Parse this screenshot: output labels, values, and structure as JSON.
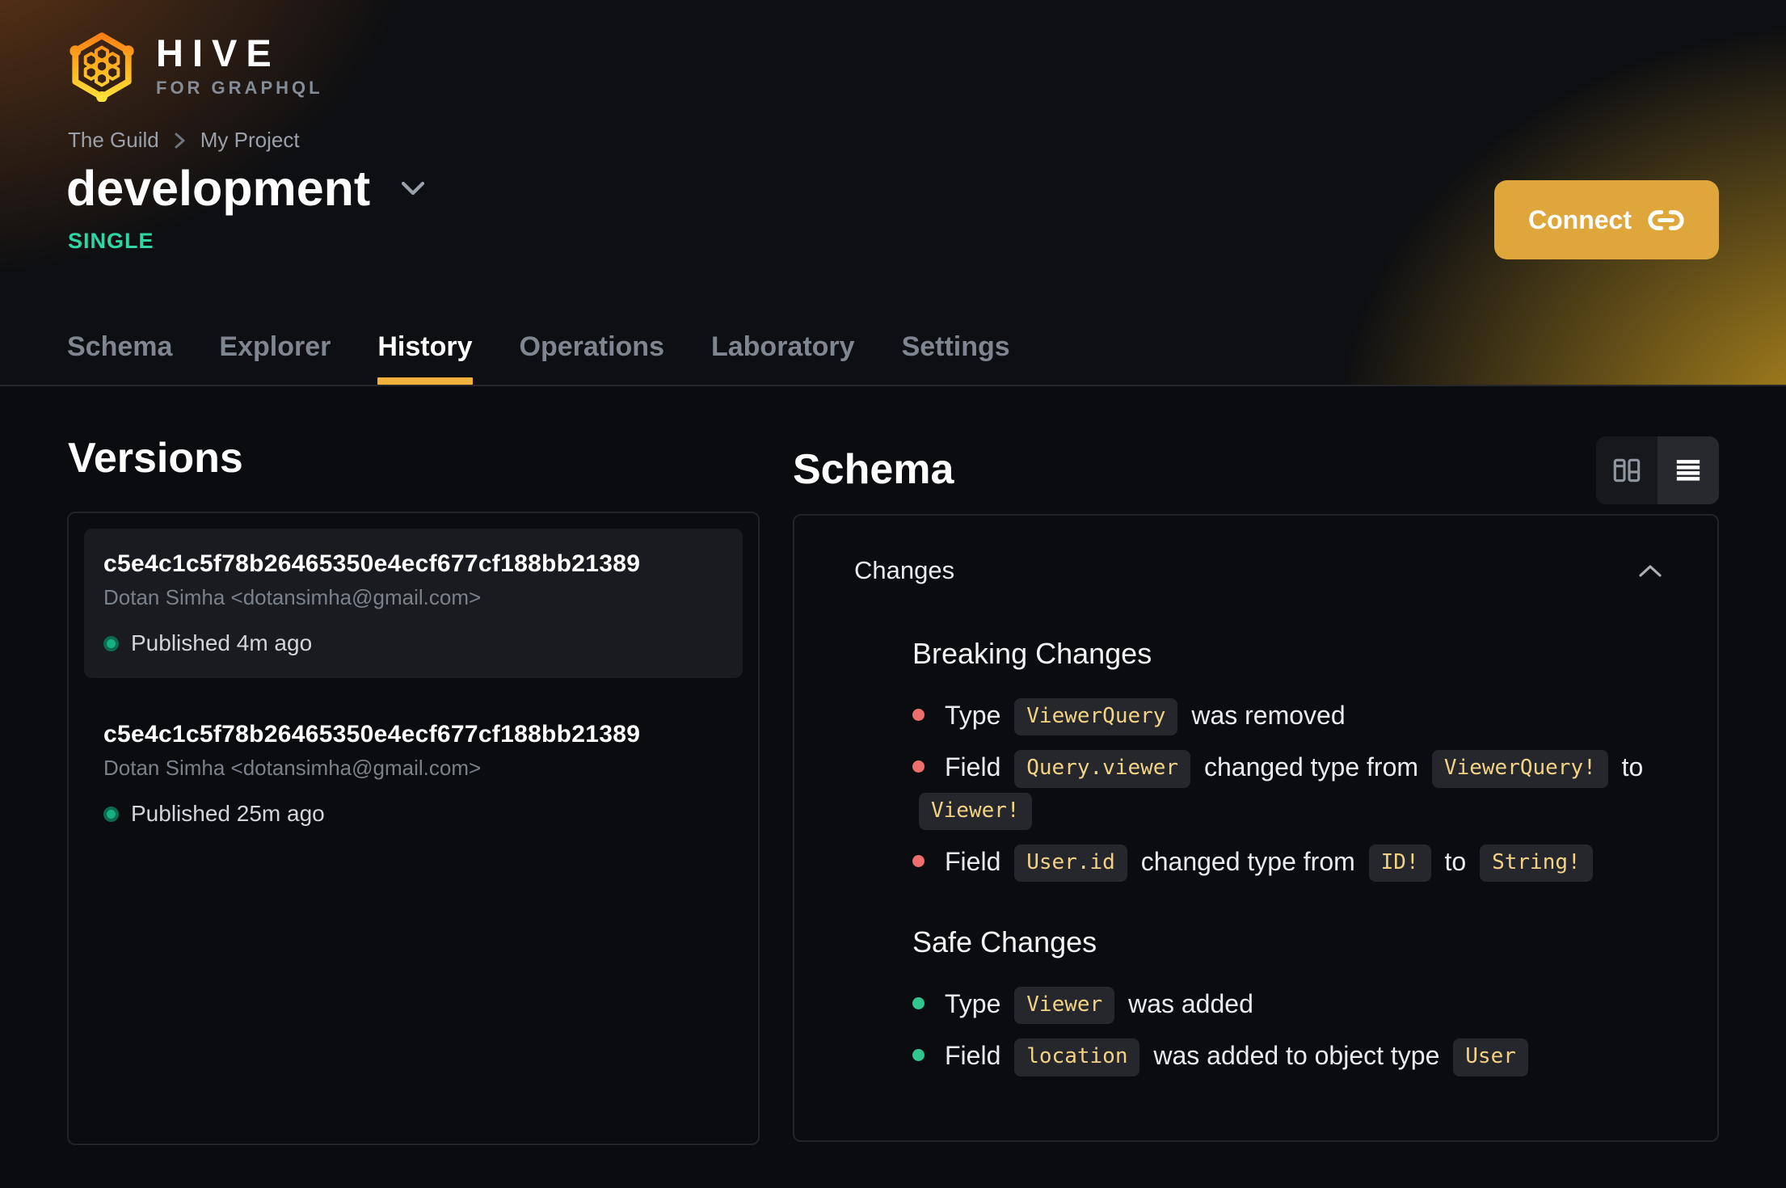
{
  "brand": {
    "name": "HIVE",
    "tagline": "FOR GRAPHQL"
  },
  "breadcrumb": {
    "org": "The Guild",
    "project": "My Project"
  },
  "header": {
    "target_name": "development",
    "badge": "SINGLE",
    "connect_label": "Connect"
  },
  "tabs": [
    {
      "label": "Schema"
    },
    {
      "label": "Explorer"
    },
    {
      "label": "History"
    },
    {
      "label": "Operations"
    },
    {
      "label": "Laboratory"
    },
    {
      "label": "Settings"
    }
  ],
  "versions": {
    "title": "Versions",
    "items": [
      {
        "hash": "c5e4c1c5f78b26465350e4ecf677cf188bb21389",
        "author": "Dotan Simha <dotansimha@gmail.com>",
        "status": "Published 4m ago"
      },
      {
        "hash": "c5e4c1c5f78b26465350e4ecf677cf188bb21389",
        "author": "Dotan Simha <dotansimha@gmail.com>",
        "status": "Published 25m ago"
      }
    ]
  },
  "schema_panel": {
    "title": "Schema",
    "changes_label": "Changes",
    "sections": [
      {
        "title": "Breaking Changes",
        "bullet_color": "#ee6d6d",
        "items": [
          {
            "parts": [
              {
                "t": "text",
                "v": "Type "
              },
              {
                "t": "code",
                "v": "ViewerQuery"
              },
              {
                "t": "text",
                "v": " was removed"
              }
            ]
          },
          {
            "parts": [
              {
                "t": "text",
                "v": "Field "
              },
              {
                "t": "code",
                "v": "Query.viewer"
              },
              {
                "t": "text",
                "v": " changed type from "
              },
              {
                "t": "code",
                "v": "ViewerQuery!"
              },
              {
                "t": "text",
                "v": " to "
              },
              {
                "t": "code",
                "v": "Viewer!"
              }
            ]
          },
          {
            "parts": [
              {
                "t": "text",
                "v": "Field "
              },
              {
                "t": "code",
                "v": "User.id"
              },
              {
                "t": "text",
                "v": " changed type from "
              },
              {
                "t": "code",
                "v": "ID!"
              },
              {
                "t": "text",
                "v": " to "
              },
              {
                "t": "code",
                "v": "String!"
              }
            ]
          }
        ]
      },
      {
        "title": "Safe Changes",
        "bullet_color": "#30c78e",
        "items": [
          {
            "parts": [
              {
                "t": "text",
                "v": "Type "
              },
              {
                "t": "code",
                "v": "Viewer"
              },
              {
                "t": "text",
                "v": " was added"
              }
            ]
          },
          {
            "parts": [
              {
                "t": "text",
                "v": "Field "
              },
              {
                "t": "code",
                "v": "location"
              },
              {
                "t": "text",
                "v": " was added to object type "
              },
              {
                "t": "code",
                "v": "User"
              }
            ]
          }
        ]
      }
    ]
  },
  "colors": {
    "accent": "#f2b13c",
    "connect_bg": "#dfa63c",
    "badge": "#2fd6a5",
    "chip_bg": "#26272c",
    "chip_text": "#f2d383"
  }
}
